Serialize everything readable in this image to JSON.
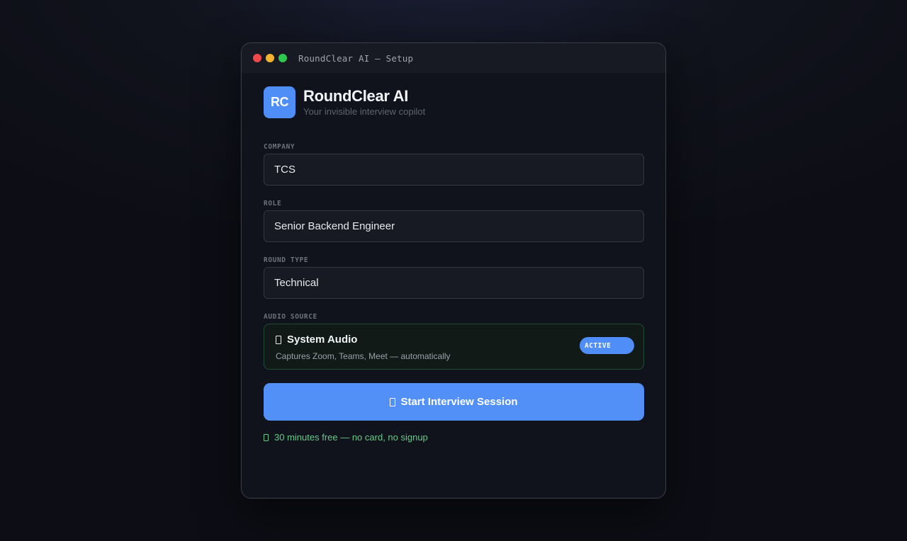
{
  "window": {
    "title": "RoundClear AI — Setup"
  },
  "brand": {
    "logo_text": "RC",
    "name": "RoundClear AI",
    "tagline": "Your invisible interview copilot"
  },
  "form": {
    "company": {
      "label": "COMPANY",
      "value": "TCS"
    },
    "role": {
      "label": "ROLE",
      "value": "Senior Backend Engineer"
    },
    "round_type": {
      "label": "ROUND TYPE",
      "value": "Technical"
    },
    "audio_source": {
      "label": "AUDIO SOURCE",
      "title": "System Audio",
      "description": "Captures Zoom, Teams, Meet — automatically",
      "badge": "ACTIVE"
    }
  },
  "actions": {
    "start_label": "Start Interview Session",
    "free_note": "30 minutes free — no card, no signup"
  },
  "colors": {
    "accent": "#5290f7",
    "success": "#69c98a",
    "window_bg": "#10131b",
    "close": "#f0474a",
    "minimize": "#f3b32b",
    "maximize": "#2ec84f"
  }
}
